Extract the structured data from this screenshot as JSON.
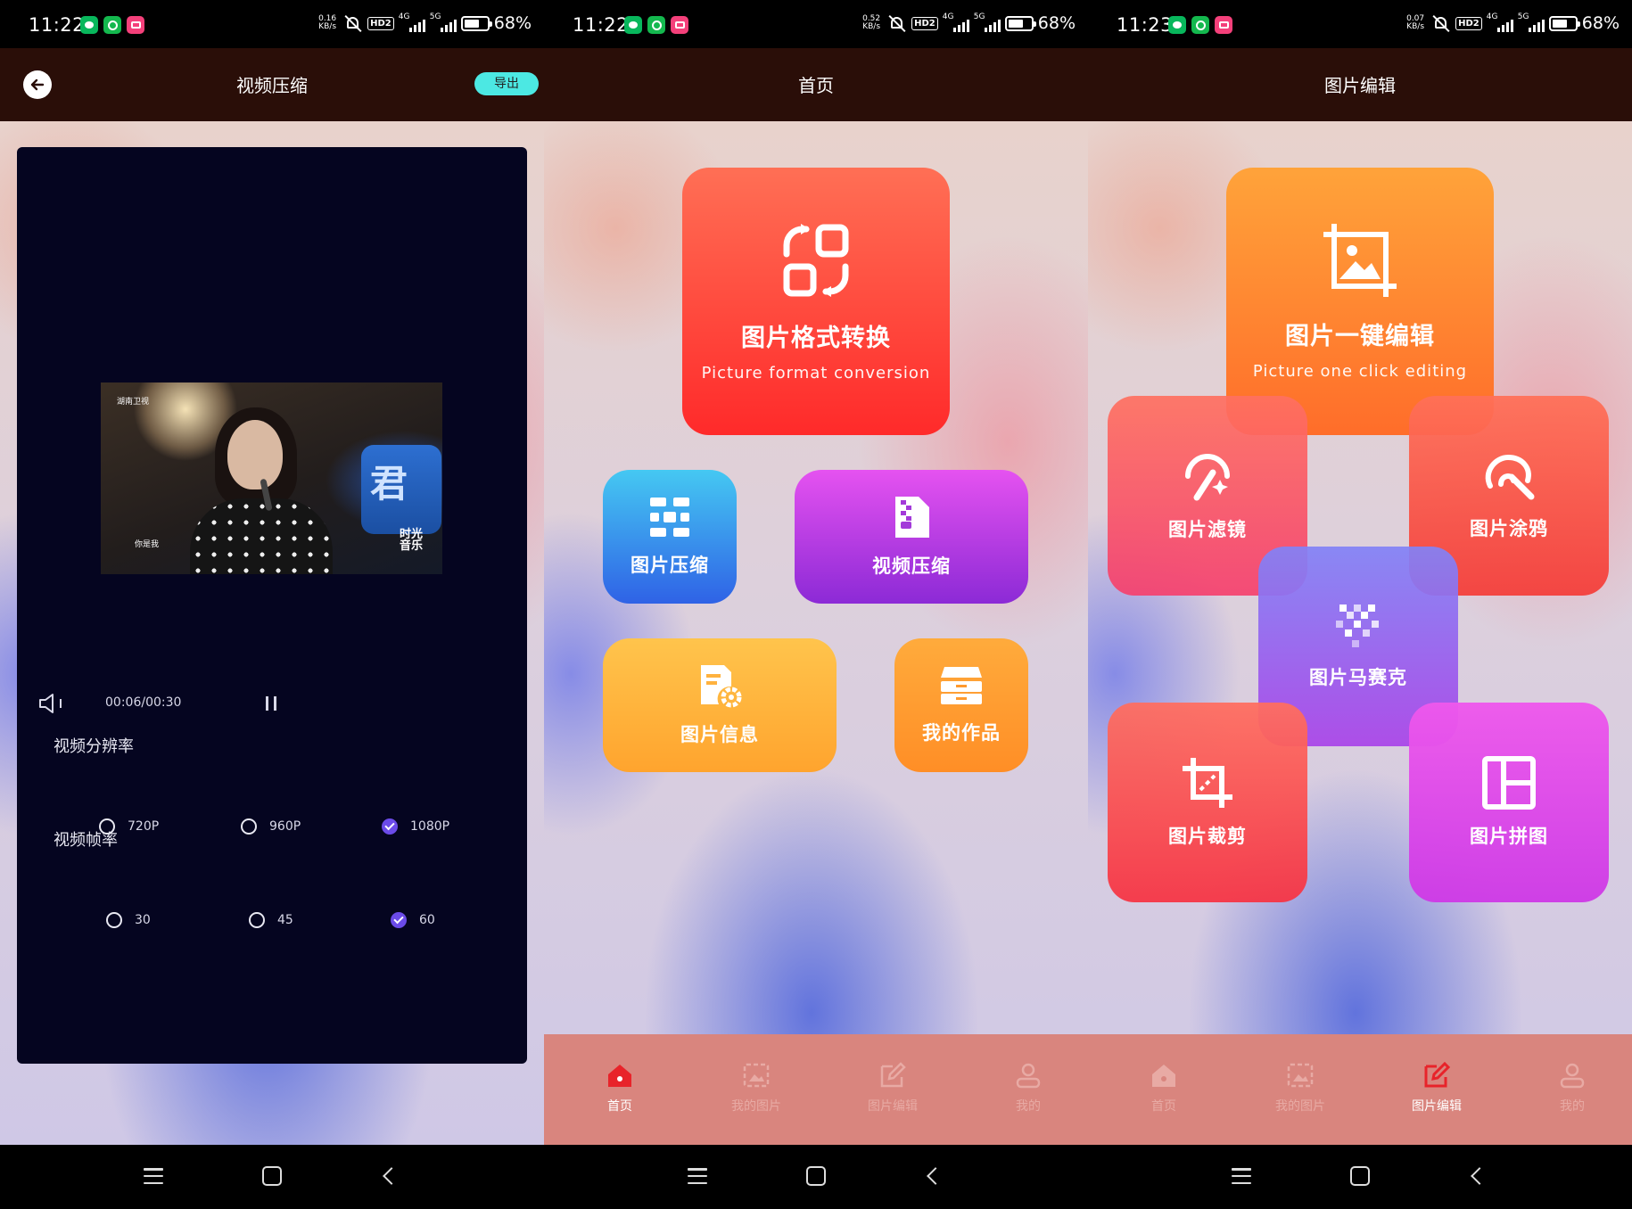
{
  "status_bars": [
    {
      "time": "11:22",
      "speed_top": "0.16",
      "speed_unit": "KB/s",
      "net1": "4G",
      "net2": "5G",
      "hd": "HD2",
      "battery": "68%"
    },
    {
      "time": "11:22",
      "speed_top": "0.52",
      "speed_unit": "KB/s",
      "net1": "4G",
      "net2": "5G",
      "hd": "HD2",
      "battery": "68%"
    },
    {
      "time": "11:23",
      "speed_top": "0.07",
      "speed_unit": "KB/s",
      "net1": "4G",
      "net2": "5G",
      "hd": "HD2",
      "battery": "68%"
    }
  ],
  "battery_level": 0.68,
  "video_screen": {
    "title": "视频压缩",
    "export_label": "导出",
    "frame_logo": "湖南卫视",
    "frame_sign": "君",
    "frame_badge_1": "时光",
    "frame_badge_2": "音乐",
    "frame_subtitle": "你是我",
    "playback_time": "00:06/00:30",
    "resolution_title": "视频分辨率",
    "resolution_options": [
      "720P",
      "960P",
      "1080P"
    ],
    "resolution_selected": "1080P",
    "framerate_title": "视频帧率",
    "framerate_options": [
      "30",
      "45",
      "60"
    ],
    "framerate_selected": "60"
  },
  "home_screen": {
    "title": "首页",
    "tiles": {
      "format_conversion": {
        "label": "图片格式转换",
        "sub": "Picture format conversion"
      },
      "image_compress": {
        "label": "图片压缩"
      },
      "video_compress": {
        "label": "视频压缩"
      },
      "image_info": {
        "label": "图片信息"
      },
      "my_works": {
        "label": "我的作品"
      }
    }
  },
  "edit_screen": {
    "title": "图片编辑",
    "tiles": {
      "one_click": {
        "label": "图片一键编辑",
        "sub": "Picture one click editing"
      },
      "filter": {
        "label": "图片滤镜"
      },
      "doodle": {
        "label": "图片涂鸦"
      },
      "mosaic": {
        "label": "图片马赛克"
      },
      "crop": {
        "label": "图片裁剪"
      },
      "collage": {
        "label": "图片拼图"
      }
    }
  },
  "bottom_tabs": [
    "首页",
    "我的图片",
    "图片编辑",
    "我的"
  ],
  "colors": {
    "header_bg": "#2a0e08",
    "export_bg": "#4ce8e3",
    "tabbar_bg": "#d9857e",
    "tab_active_icon": "#e8232a",
    "radio_checked": "#6b4be8"
  }
}
